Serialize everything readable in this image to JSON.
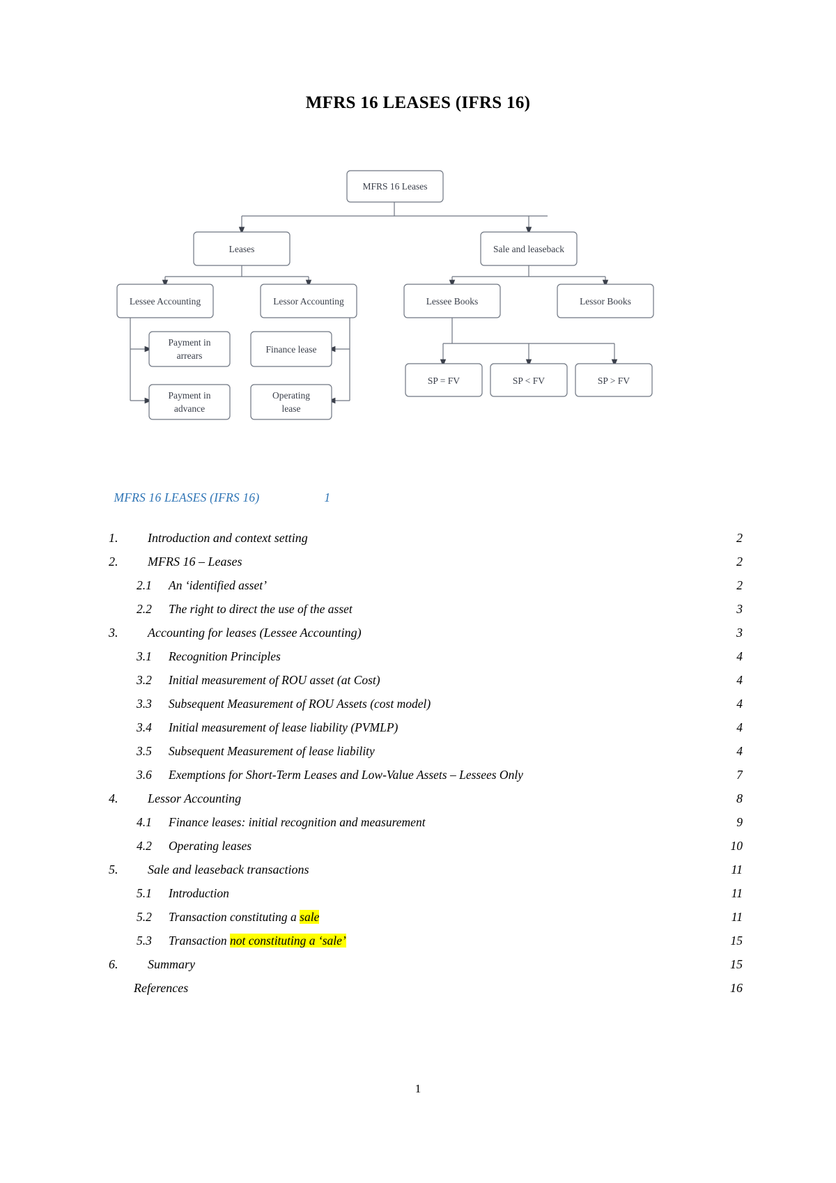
{
  "document": {
    "title": "MFRS 16 LEASES (IFRS 16)",
    "page_number": "1"
  },
  "diagram": {
    "title": "MFRS 16 Leases hierarchy",
    "nodes": {
      "root": "MFRS 16 Leases",
      "leases": "Leases",
      "sale_and_leaseback": "Sale and leaseback",
      "lessee_accounting": "Lessee Accounting",
      "lessor_accounting": "Lessor Accounting",
      "lessee_books": "Lessee Books",
      "lessor_books": "Lessor Books",
      "payment_in_arrears": "Payment in arrears",
      "payment_in_advance": "Payment in advance",
      "finance_lease": "Finance lease",
      "operating_lease": "Operating lease",
      "sp_eq_fv": "SP = FV",
      "sp_lt_fv": "SP < FV",
      "sp_gt_fv": "SP > FV"
    },
    "box_border_color": "#6f7682",
    "box_text_color": "#3a3f4a"
  },
  "toc": {
    "heading": "MFRS 16 LEASES (IFRS 16)",
    "heading_page": "1",
    "heading_color": "#2E74B5",
    "highlight_color": "#FFFF00",
    "entries": [
      {
        "level": 1,
        "num": "1.",
        "title": "Introduction and context setting",
        "page": "2",
        "leader": "fine"
      },
      {
        "level": 1,
        "num": "2.",
        "title": "MFRS 16 – Leases",
        "page": "2",
        "leader": "fine"
      },
      {
        "level": 2,
        "num": "2.1",
        "title": "An ‘identified asset’",
        "page": "2",
        "leader": "coarse"
      },
      {
        "level": 2,
        "num": "2.2",
        "title": "The right to direct the use of the asset",
        "page": "3",
        "leader": "coarse"
      },
      {
        "level": 1,
        "num": "3.",
        "title": "Accounting for leases (Lessee Accounting)",
        "page": "3",
        "leader": "fine"
      },
      {
        "level": 2,
        "num": "3.1",
        "title": "Recognition Principles",
        "page": "4",
        "leader": "coarse"
      },
      {
        "level": 2,
        "num": "3.2",
        "title": "Initial measurement of ROU asset (at Cost)",
        "page": "4",
        "leader": "coarse"
      },
      {
        "level": 2,
        "num": "3.3",
        "title": "Subsequent Measurement of ROU Assets (cost model)",
        "page": "4",
        "leader": "coarse"
      },
      {
        "level": 2,
        "num": "3.4",
        "title": "Initial measurement of lease liability (PVMLP)",
        "page": "4",
        "leader": "coarse"
      },
      {
        "level": 2,
        "num": "3.5",
        "title": "Subsequent Measurement of lease liability",
        "page": "4",
        "leader": "coarse"
      },
      {
        "level": 2,
        "num": "3.6",
        "title": "Exemptions for Short-Term Leases and Low-Value Assets – Lessees Only",
        "page": "7",
        "leader": "coarse"
      },
      {
        "level": 1,
        "num": "4.",
        "title": "Lessor Accounting",
        "page": "8",
        "leader": "fine"
      },
      {
        "level": 2,
        "num": "4.1",
        "title": "Finance leases: initial recognition and measurement",
        "page": "9",
        "leader": "coarse"
      },
      {
        "level": 2,
        "num": "4.2",
        "title": "Operating leases",
        "page": "10",
        "leader": "coarse"
      },
      {
        "level": 1,
        "num": "5.",
        "title": "Sale and leaseback transactions",
        "page": "11",
        "leader": "fine"
      },
      {
        "level": 2,
        "num": "5.1",
        "title": "Introduction",
        "page": "11",
        "leader": "coarse"
      },
      {
        "level": 2,
        "num": "5.2",
        "title": "Transaction constituting a ",
        "highlight": "sale",
        "title_after": "",
        "page": "11",
        "leader": "coarse"
      },
      {
        "level": 2,
        "num": "5.3",
        "title": "Transaction ",
        "highlight": "not constituting a ‘sale’",
        "title_after": "",
        "page": "15",
        "leader": "coarse"
      },
      {
        "level": 1,
        "num": "6.",
        "title": "Summary",
        "page": "15",
        "leader": "fine"
      },
      {
        "level": 0,
        "num": "",
        "title": "References",
        "page": "16",
        "leader": "fine"
      }
    ]
  }
}
